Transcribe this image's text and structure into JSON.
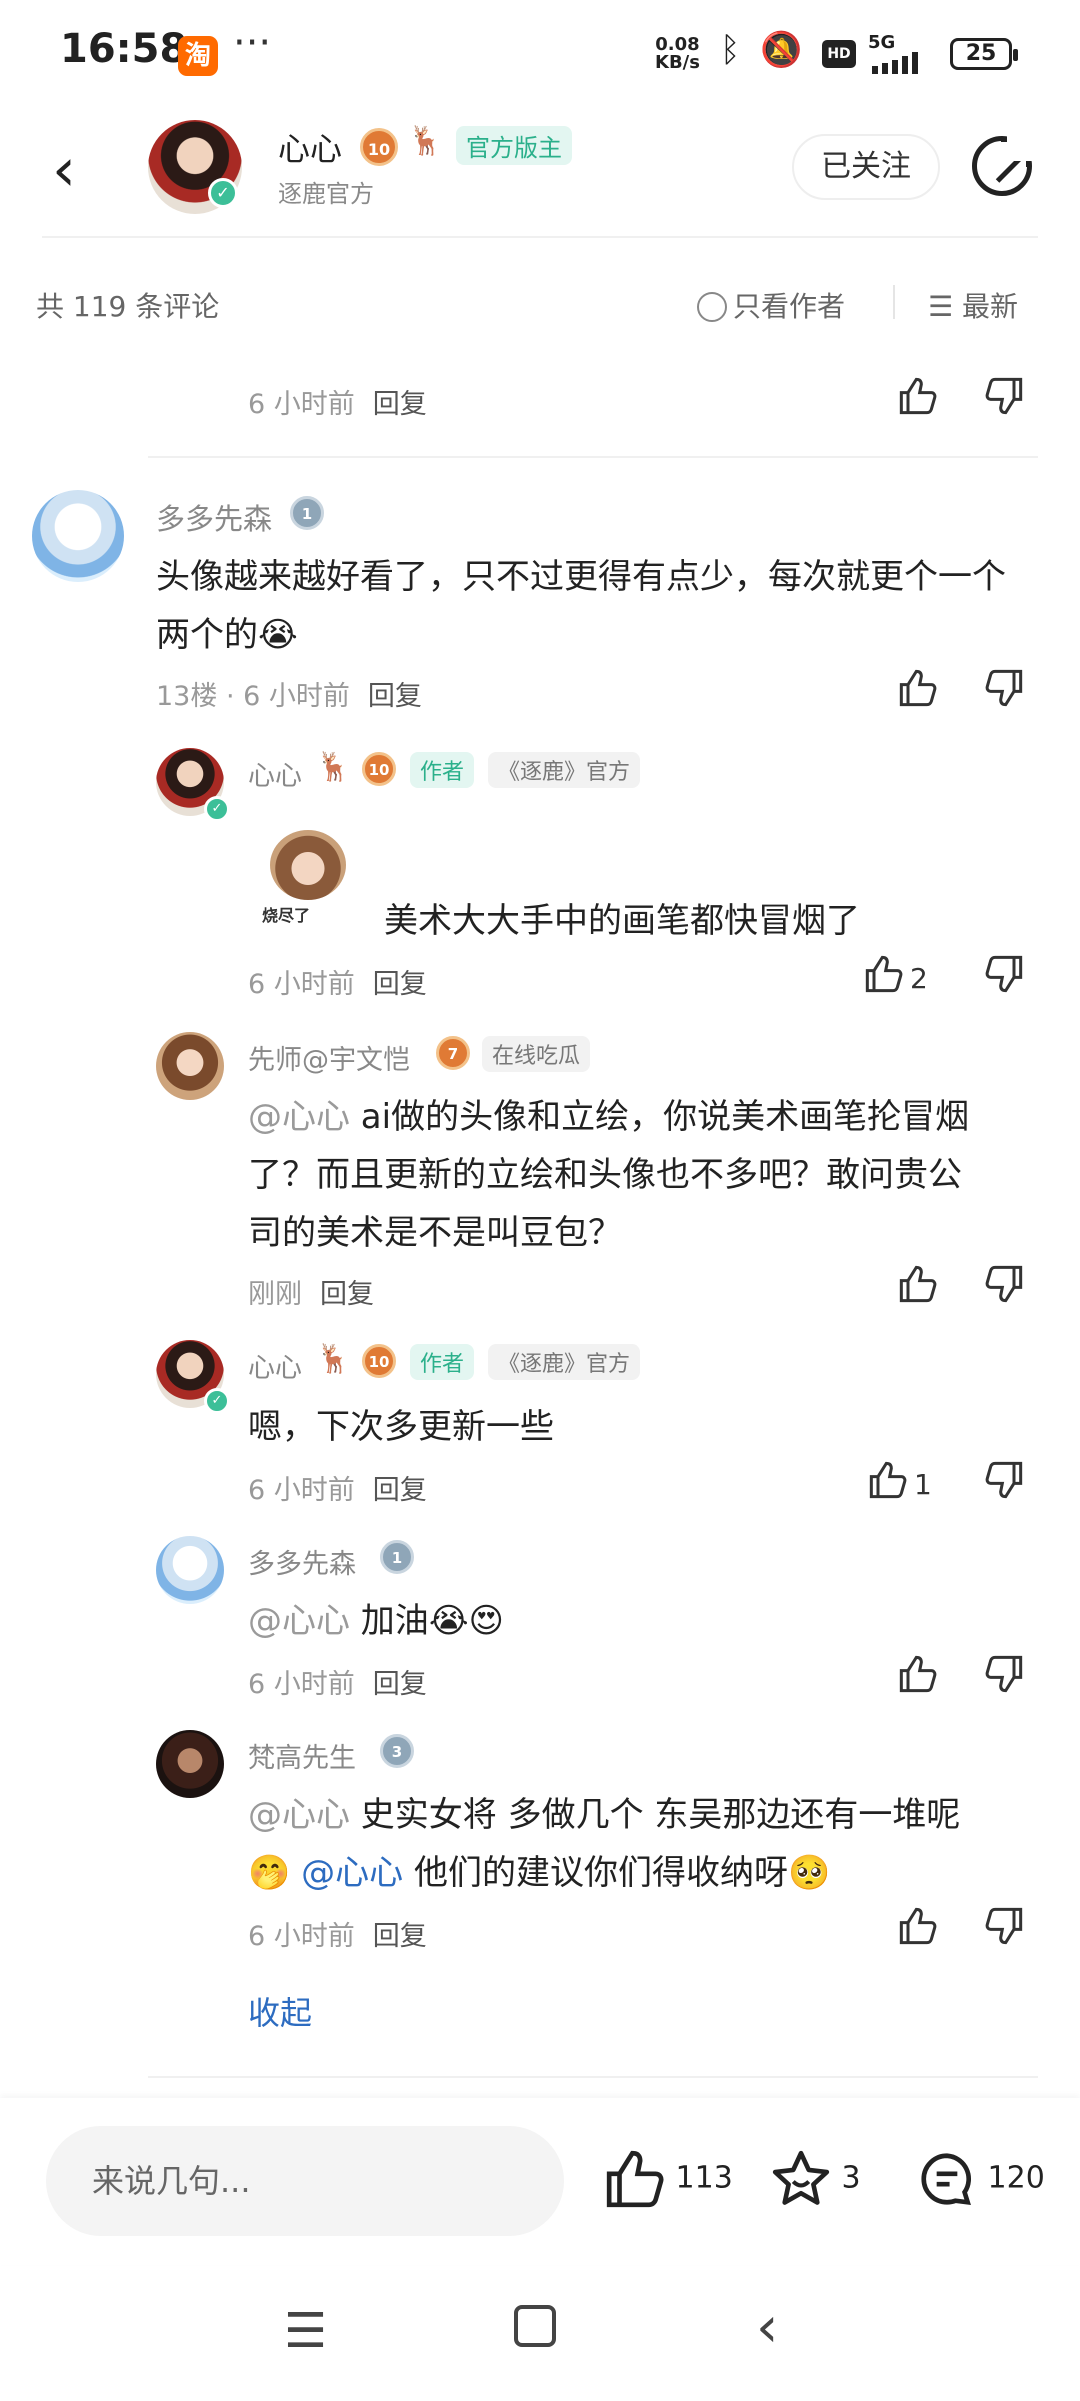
{
  "status": {
    "time": "16:58",
    "speed_top": "0.08",
    "speed_bottom": "KB/s",
    "network": "5G",
    "battery": "25"
  },
  "header": {
    "user_name": "心心",
    "level": "10",
    "role_tag": "官方版主",
    "subtitle": "逐鹿官方",
    "follow_label": "已关注"
  },
  "filter": {
    "count": "共 119 条评论",
    "only_author": "只看作者",
    "sort": "最新"
  },
  "top_meta": {
    "time": "6 小时前",
    "reply": "回复"
  },
  "comments": [
    {
      "user": "多多先森",
      "level": "1",
      "text": "头像越来越好看了，只不过更得有点少，每次就更个一个两个的",
      "emoji": "😭",
      "floor_time": "13楼 · 6 小时前",
      "reply": "回复"
    }
  ],
  "replies": [
    {
      "user": "心心",
      "level": "10",
      "tag_author": "作者",
      "tag_official": "《逐鹿》官方",
      "sticker_text": "烧尽了",
      "text": "美术大大手中的画笔都快冒烟了",
      "time": "6 小时前",
      "reply": "回复",
      "likes": "2"
    },
    {
      "user": "先师@宇文恺",
      "level": "7",
      "tag": "在线吃瓜",
      "mention": "@心心",
      "text_a": " ai做的头像和立绘，你说美术画笔抡冒烟",
      "text_b": "了？而且更新的立绘和头像也不多吧？敢问贵公",
      "text_c": "司的美术是不是叫豆包？",
      "time": "刚刚",
      "reply": "回复"
    },
    {
      "user": "心心",
      "level": "10",
      "tag_author": "作者",
      "tag_official": "《逐鹿》官方",
      "text": "嗯，下次多更新一些",
      "time": "6 小时前",
      "reply": "回复",
      "likes": "1"
    },
    {
      "user": "多多先森",
      "level": "1",
      "mention": "@心心",
      "text": " 加油",
      "emoji": "😭😍",
      "time": "6 小时前",
      "reply": "回复"
    },
    {
      "user": "梵高先生",
      "level": "3",
      "mention": "@心心",
      "text_a": " 史实女将 多做几个 东吴那边还有一堆呢",
      "emoji_a": "🤭",
      "mention_b": "@心心",
      "text_b": " 他们的建议你们得收纳呀",
      "emoji_b": "🥺",
      "time": "6 小时前",
      "reply": "回复"
    }
  ],
  "collapse": "收起",
  "bottom": {
    "placeholder": "来说几句...",
    "likes": "113",
    "favorites": "3",
    "comments": "120"
  }
}
